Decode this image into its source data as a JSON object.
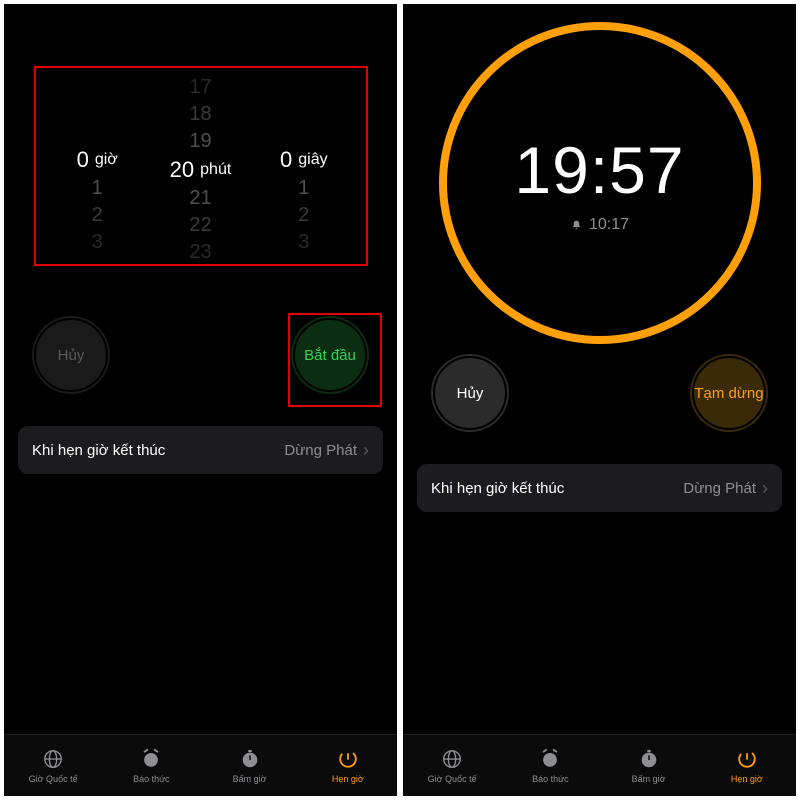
{
  "left": {
    "picker": {
      "hours": {
        "above": [
          "",
          "",
          ""
        ],
        "value": "0",
        "unit": "giờ",
        "below": [
          "1",
          "2",
          "3"
        ]
      },
      "minutes": {
        "above": [
          "17",
          "18",
          "19"
        ],
        "value": "20",
        "unit": "phút",
        "below": [
          "21",
          "22",
          "23"
        ]
      },
      "seconds": {
        "above": [
          "",
          "",
          ""
        ],
        "value": "0",
        "unit": "giây",
        "below": [
          "1",
          "2",
          "3"
        ]
      }
    },
    "buttons": {
      "cancel": "Hủy",
      "start": "Bắt đầu"
    },
    "option": {
      "label": "Khi hẹn giờ kết thúc",
      "value": "Dừng Phát"
    }
  },
  "right": {
    "countdown": "19:57",
    "eta": "10:17",
    "buttons": {
      "cancel": "Hủy",
      "pause": "Tạm dừng"
    },
    "option": {
      "label": "Khi hẹn giờ kết thúc",
      "value": "Dừng Phát"
    }
  },
  "tabs": {
    "world": "Giờ Quốc tế",
    "alarm": "Báo thức",
    "stopwatch": "Bấm giờ",
    "timer": "Hẹn giờ"
  }
}
